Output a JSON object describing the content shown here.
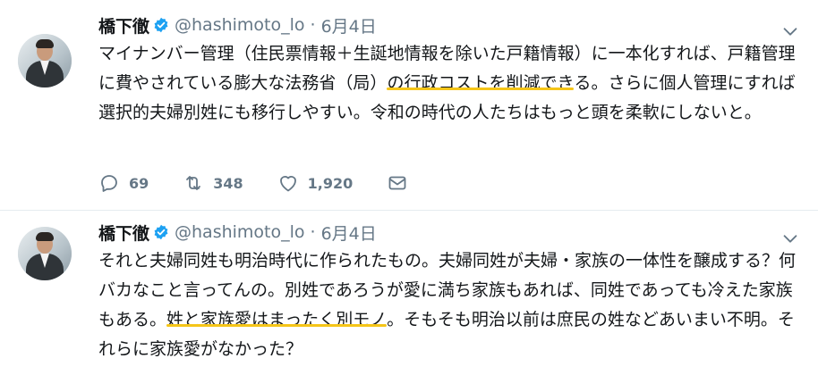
{
  "tweets": [
    {
      "author": "橋下徹",
      "handle": "@hashimoto_lo",
      "separator": "·",
      "date": "6月4日",
      "text_before": "マイナンバー管理（住民票情報＋生誕地情報を除いた戸籍情報）に一本化すれば、戸籍管理に費やされている膨大な法務省（局）",
      "text_highlight": "の行政コストを削減でき",
      "text_after": "る。さらに個人管理にすれば選択的夫婦別姓にも移行しやすい。令和の時代の人たちはもっと頭を柔軟にしないと。",
      "replies": "69",
      "retweets": "348",
      "likes": "1,920"
    },
    {
      "author": "橋下徹",
      "handle": "@hashimoto_lo",
      "separator": "·",
      "date": "6月4日",
      "text_before": "それと夫婦同姓も明治時代に作られたもの。夫婦同姓が夫婦・家族の一体性を醸成する？何バカなこと言ってんの。別姓であろうが愛に満ち家族もあれば、同姓であっても冷えた家族もある。",
      "text_highlight": "姓と家族愛はまったく別モノ",
      "text_after": "。そもそも明治以前は庶民の姓などあいまい不明。それらに家族愛がなかった？"
    }
  ],
  "icons": {
    "verified": "verified-badge-icon",
    "caret": "chevron-down-icon",
    "reply": "reply-icon",
    "retweet": "retweet-icon",
    "like": "heart-icon",
    "dm": "envelope-icon"
  },
  "colors": {
    "verified": "#1da1f2",
    "highlight": "#f5c518",
    "secondary_text": "#657786"
  }
}
